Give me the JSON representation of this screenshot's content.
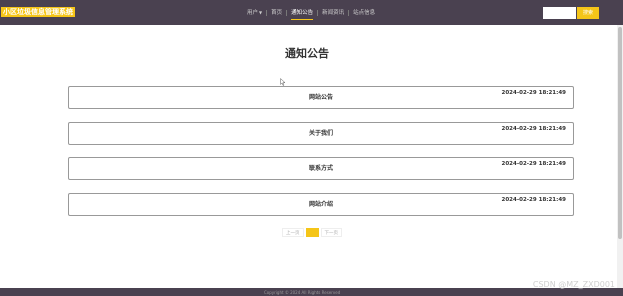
{
  "header": {
    "logo_text": "小区垃圾信息管理系统",
    "nav": [
      {
        "label": "用户",
        "has_dropdown": true
      },
      {
        "label": "首页"
      },
      {
        "label": "通知公告",
        "active": true
      },
      {
        "label": "新闻资讯"
      },
      {
        "label": "站点信息"
      }
    ],
    "search_placeholder": "",
    "search_button": "搜索"
  },
  "main": {
    "title": "通知公告",
    "notices": [
      {
        "title": "网站公告",
        "time": "2024-02-29 18:21:49"
      },
      {
        "title": "关于我们",
        "time": "2024-02-29 18:21:49"
      },
      {
        "title": "联系方式",
        "time": "2024-02-29 18:21:49"
      },
      {
        "title": "网站介绍",
        "time": "2024-02-29 18:21:49"
      }
    ],
    "pagination": {
      "prev": "上一页",
      "current": "1",
      "next": "下一页"
    }
  },
  "footer": {
    "text": "Copyright © 2024 All Rights Reserved"
  },
  "watermark": "CSDN @MZ_ZXD001",
  "colors": {
    "header_bg": "#4a4150",
    "accent": "#f5c518"
  }
}
